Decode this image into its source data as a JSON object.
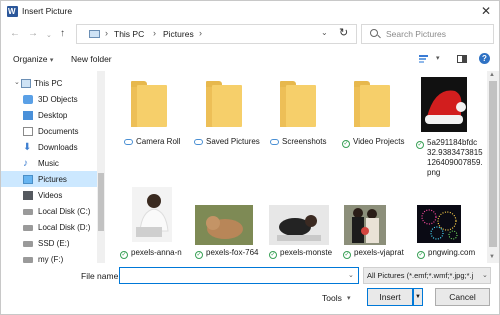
{
  "window": {
    "title": "Insert Picture",
    "icon": "word-app-icon"
  },
  "address": {
    "crumbs": [
      "This PC",
      "Pictures"
    ],
    "search_placeholder": "Search Pictures"
  },
  "toolbar": {
    "organize_label": "Organize",
    "new_folder_label": "New folder"
  },
  "sidebar": {
    "items": [
      {
        "label": "This PC",
        "icon": "pc-icon"
      },
      {
        "label": "3D Objects",
        "icon": "cube-icon"
      },
      {
        "label": "Desktop",
        "icon": "desktop-icon"
      },
      {
        "label": "Documents",
        "icon": "document-icon"
      },
      {
        "label": "Downloads",
        "icon": "download-icon"
      },
      {
        "label": "Music",
        "icon": "music-icon"
      },
      {
        "label": "Pictures",
        "icon": "pictures-icon",
        "selected": true
      },
      {
        "label": "Videos",
        "icon": "video-icon"
      },
      {
        "label": "Local Disk (C:)",
        "icon": "disk-icon"
      },
      {
        "label": "Local Disk (D:)",
        "icon": "disk-icon"
      },
      {
        "label": "SSD (E:)",
        "icon": "disk-icon"
      },
      {
        "label": "my (F:)",
        "icon": "disk-icon"
      }
    ]
  },
  "files": {
    "folders": [
      {
        "name": "Camera Roll",
        "status": "cloud"
      },
      {
        "name": "Saved Pictures",
        "status": "cloud"
      },
      {
        "name": "Screenshots",
        "status": "cloud"
      },
      {
        "name": "Video Projects",
        "status": "synced"
      }
    ],
    "image_row1": {
      "name_lines": [
        "5a291184bfdc",
        "32.9383473815",
        "126409007859.",
        "png"
      ],
      "status": "synced"
    },
    "images": [
      {
        "name": "pexels-anna-n",
        "status": "synced"
      },
      {
        "name": "pexels-fox-764",
        "status": "synced"
      },
      {
        "name": "pexels-monste",
        "status": "synced"
      },
      {
        "name": "pexels-vjaprat",
        "status": "synced"
      },
      {
        "name": "pngwing.com",
        "status": "synced"
      }
    ]
  },
  "bottom": {
    "file_name_label": "File name:",
    "file_name_value": "",
    "file_type_value": "All Pictures (*.emf;*.wmf;*.jpg;*.j",
    "tools_label": "Tools",
    "insert_label": "Insert",
    "cancel_label": "Cancel"
  },
  "colors": {
    "accent": "#0078d7",
    "selected_bg": "#cce8ff",
    "folder": "#f6cf6a"
  }
}
